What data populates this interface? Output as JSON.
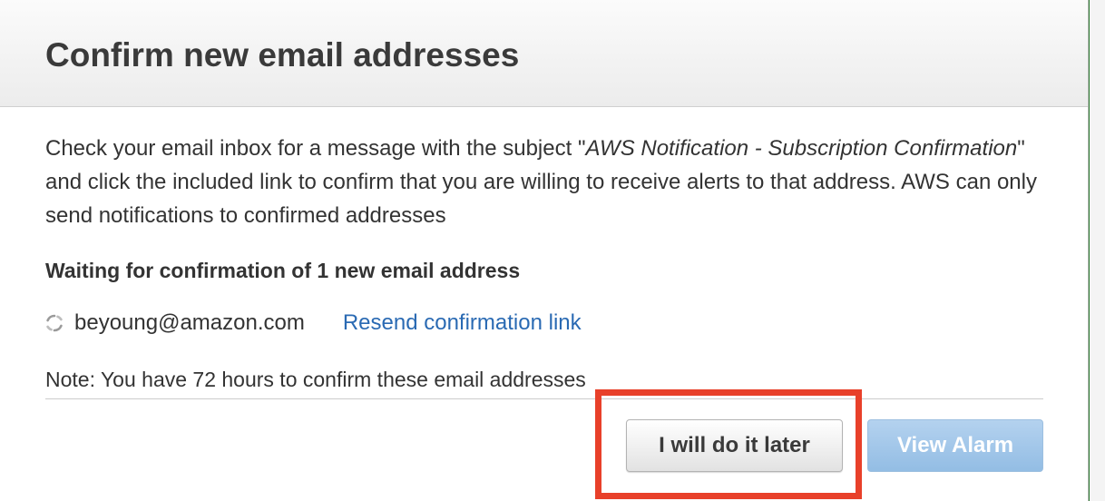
{
  "dialog": {
    "title": "Confirm new email addresses",
    "description": {
      "part1": "Check your email inbox for a message with the subject \"",
      "subject": "AWS Notification - Subscription Confirmation",
      "part2": "\" and click the included link to confirm that you are willing to receive alerts to that address. AWS can only send notifications to confirmed addresses"
    },
    "waiting_heading": "Waiting for confirmation of 1 new email address",
    "pending_emails": [
      {
        "icon": "refresh-icon",
        "address": "beyoung@amazon.com",
        "resend_label": "Resend confirmation link"
      }
    ],
    "note": "Note: You have 72 hours to confirm these email addresses",
    "buttons": {
      "later_label": "I will do it later",
      "view_alarm_label": "View Alarm"
    }
  },
  "colors": {
    "link": "#2a6ab3",
    "primary_button": "#a5c8ea",
    "highlight": "#e8402a"
  }
}
